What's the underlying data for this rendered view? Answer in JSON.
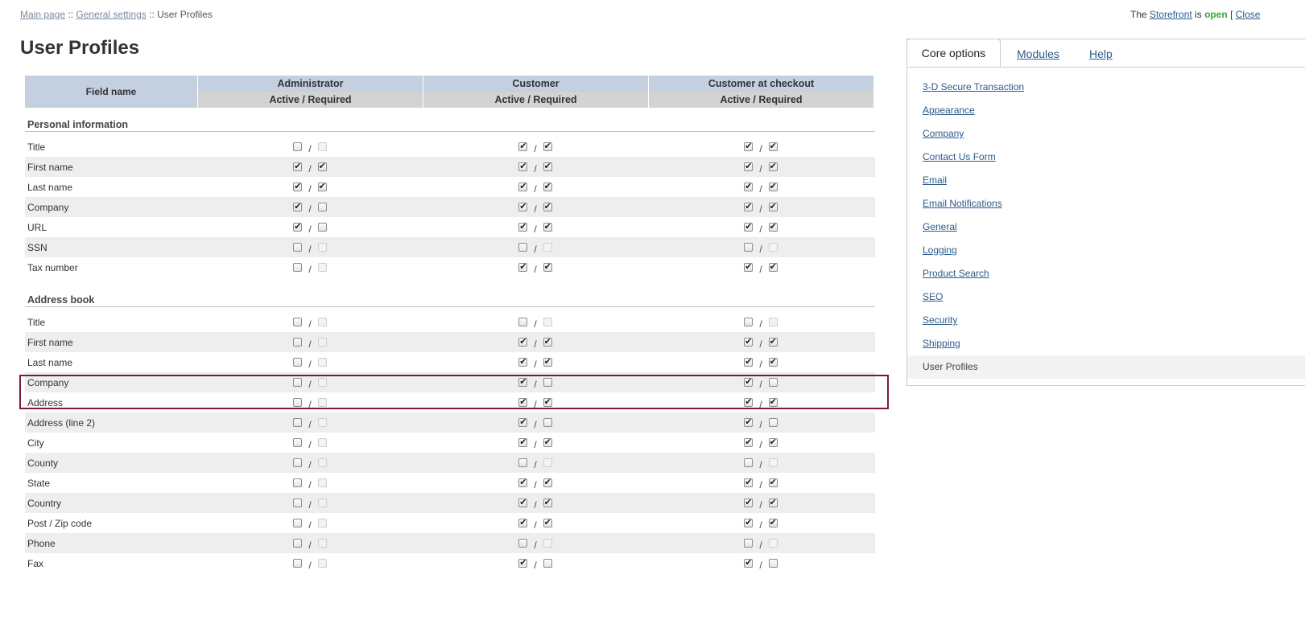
{
  "breadcrumb": {
    "home": "Main page",
    "sep1": " :: ",
    "general": "General settings",
    "sep2": " :: ",
    "current": "User Profiles"
  },
  "status": {
    "prefix": "The ",
    "link": "Storefront",
    "mid": " is ",
    "state": "open",
    "bracket": " [ ",
    "close": "Close"
  },
  "page_title": "User Profiles",
  "table": {
    "field_name_header": "Field name",
    "groups": [
      "Administrator",
      "Customer",
      "Customer at checkout"
    ],
    "subheader": "Active / Required",
    "slash": "/",
    "sections": [
      {
        "title": "Personal information",
        "rows": [
          {
            "label": "Title",
            "v": [
              [
                0,
                0,
                0,
                0,
                0,
                1
              ],
              [
                1,
                1
              ],
              [
                1,
                1
              ]
            ]
          },
          {
            "label": "First name",
            "v": [
              [
                1,
                1
              ],
              [
                1,
                1
              ],
              [
                1,
                1
              ]
            ]
          },
          {
            "label": "Last name",
            "v": [
              [
                1,
                1
              ],
              [
                1,
                1
              ],
              [
                1,
                1
              ]
            ]
          },
          {
            "label": "Company",
            "v": [
              [
                1,
                0
              ],
              [
                1,
                1
              ],
              [
                1,
                1
              ]
            ]
          },
          {
            "label": "URL",
            "v": [
              [
                1,
                0
              ],
              [
                1,
                1
              ],
              [
                1,
                1
              ]
            ]
          },
          {
            "label": "SSN",
            "v": [
              [
                0,
                0
              ],
              [
                0,
                0
              ],
              [
                0,
                0
              ]
            ]
          },
          {
            "label": "Tax number",
            "v": [
              [
                0,
                0
              ],
              [
                1,
                1
              ],
              [
                1,
                1
              ]
            ]
          }
        ]
      },
      {
        "title": "Address book",
        "rows": [
          {
            "label": "Title",
            "v": [
              [
                0,
                0
              ],
              [
                0,
                0
              ],
              [
                0,
                0
              ]
            ]
          },
          {
            "label": "First name",
            "v": [
              [
                0,
                0
              ],
              [
                1,
                1
              ],
              [
                1,
                1
              ]
            ]
          },
          {
            "label": "Last name",
            "v": [
              [
                0,
                0
              ],
              [
                1,
                1
              ],
              [
                1,
                1
              ]
            ]
          },
          {
            "label": "Company",
            "v": [
              [
                0,
                0
              ],
              [
                1,
                0
              ],
              [
                1,
                0
              ]
            ]
          },
          {
            "label": "Address",
            "v": [
              [
                0,
                0
              ],
              [
                1,
                1
              ],
              [
                1,
                1
              ]
            ]
          },
          {
            "label": "Address (line 2)",
            "v": [
              [
                0,
                0
              ],
              [
                1,
                0
              ],
              [
                1,
                0
              ]
            ]
          },
          {
            "label": "City",
            "v": [
              [
                0,
                0
              ],
              [
                1,
                1
              ],
              [
                1,
                1
              ]
            ]
          },
          {
            "label": "County",
            "v": [
              [
                0,
                0
              ],
              [
                0,
                0
              ],
              [
                0,
                0
              ]
            ]
          },
          {
            "label": "State",
            "v": [
              [
                0,
                0
              ],
              [
                1,
                1
              ],
              [
                1,
                1
              ]
            ]
          },
          {
            "label": "Country",
            "v": [
              [
                0,
                0
              ],
              [
                1,
                1
              ],
              [
                1,
                1
              ]
            ]
          },
          {
            "label": "Post / Zip code",
            "v": [
              [
                0,
                0
              ],
              [
                1,
                1
              ],
              [
                1,
                1
              ]
            ]
          },
          {
            "label": "Phone",
            "v": [
              [
                0,
                0
              ],
              [
                0,
                0
              ],
              [
                0,
                0
              ]
            ]
          },
          {
            "label": "Fax",
            "v": [
              [
                0,
                0
              ],
              [
                1,
                0
              ],
              [
                1,
                0
              ]
            ]
          }
        ]
      }
    ]
  },
  "panel": {
    "tabs": [
      "Core options",
      "Modules",
      "Help"
    ],
    "menu": [
      "3-D Secure Transaction",
      "Appearance",
      "Company",
      "Contact Us Form",
      "Email",
      "Email Notifications",
      "General",
      "Logging",
      "Product Search",
      "SEO",
      "Security",
      "Shipping",
      "User Profiles"
    ]
  }
}
